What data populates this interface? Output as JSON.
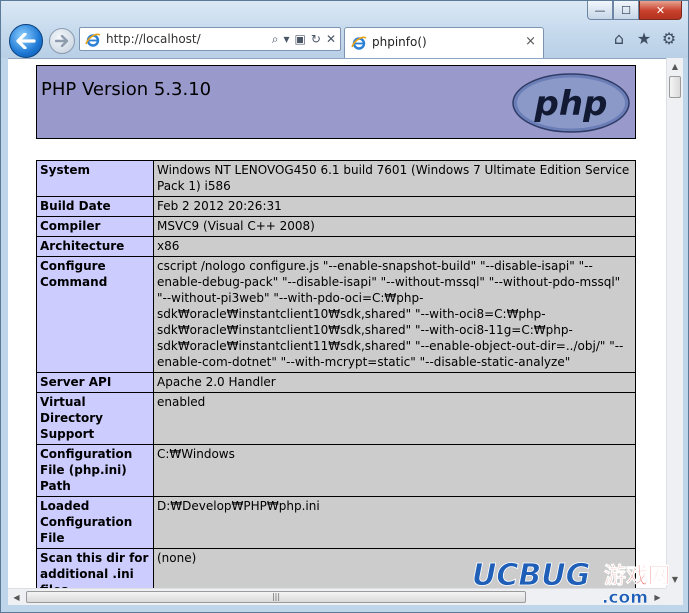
{
  "browser": {
    "address": "http://localhost/",
    "tab_title": "phpinfo()",
    "tab_close": "×",
    "caption_min": "—",
    "caption_max": "☐",
    "caption_close": "✕",
    "address_tools": [
      "⌕",
      "▾",
      "▣",
      "↻",
      "✕"
    ],
    "toolbar_icons": [
      "⌂",
      "★",
      "⚙"
    ]
  },
  "page": {
    "php_version": "PHP Version 5.3.10",
    "logo_text": "php"
  },
  "table": {
    "rows": [
      {
        "key": "System",
        "value": "Windows NT LENOVOG450 6.1 build 7601 (Windows 7 Ultimate Edition Service Pack 1) i586"
      },
      {
        "key": "Build Date",
        "value": "Feb 2 2012 20:26:31"
      },
      {
        "key": "Compiler",
        "value": "MSVC9 (Visual C++ 2008)"
      },
      {
        "key": "Architecture",
        "value": "x86"
      },
      {
        "key": "Configure Command",
        "value": "cscript /nologo configure.js \"--enable-snapshot-build\" \"--disable-isapi\" \"--enable-debug-pack\" \"--disable-isapi\" \"--without-mssql\" \"--without-pdo-mssql\" \"--without-pi3web\" \"--with-pdo-oci=C:₩php-sdk₩oracle₩instantclient10₩sdk,shared\" \"--with-oci8=C:₩php-sdk₩oracle₩instantclient10₩sdk,shared\" \"--with-oci8-11g=C:₩php-sdk₩oracle₩instantclient11₩sdk,shared\" \"--enable-object-out-dir=../obj/\" \"--enable-com-dotnet\" \"--with-mcrypt=static\" \"--disable-static-analyze\""
      },
      {
        "key": "Server API",
        "value": "Apache 2.0 Handler"
      },
      {
        "key": "Virtual Directory Support",
        "value": "enabled"
      },
      {
        "key": "Configuration File (php.ini) Path",
        "value": "C:₩Windows"
      },
      {
        "key": "Loaded Configuration File",
        "value": "D:₩Develop₩PHP₩php.ini"
      },
      {
        "key": "Scan this dir for additional .ini files",
        "value": "(none)"
      }
    ]
  },
  "watermark": {
    "brand": "UCBUG",
    "chinese": "游戏网",
    "domain": ".com"
  },
  "colors": {
    "header_bg": "#9999cc",
    "key_bg": "#ccccff",
    "value_bg": "#cccccc",
    "watermark_blue": "#1f5fb8",
    "watermark_red": "#d7261f"
  }
}
